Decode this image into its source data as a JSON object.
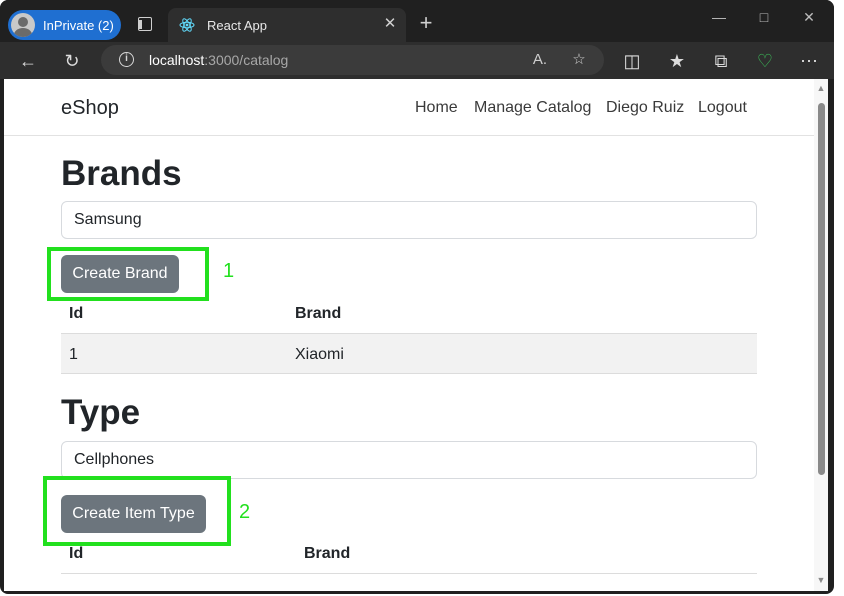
{
  "browser": {
    "profile_label": "InPrivate (2)",
    "tab_title": "React App",
    "tab_close": "✕",
    "new_tab": "+",
    "url_host": "localhost",
    "url_path": ":3000/catalog",
    "icons": [
      "tabs-icon",
      "react-icon",
      "back-icon",
      "refresh-icon",
      "info-icon",
      "read-aloud-icon",
      "favorite-star-icon",
      "split-screen-icon",
      "favorites-icon",
      "collections-icon",
      "health-icon",
      "more-icon"
    ]
  },
  "app": {
    "brand": "eShop",
    "nav": [
      "Home",
      "Manage Catalog",
      "Diego Ruiz",
      "Logout"
    ]
  },
  "brands": {
    "heading": "Brands",
    "input_value": "Samsung",
    "button": "Create Brand",
    "annotation": "1",
    "columns": [
      "Id",
      "Brand"
    ],
    "rows": [
      {
        "id": "1",
        "brand": "Xiaomi"
      }
    ]
  },
  "types": {
    "heading": "Type",
    "input_value": "Cellphones",
    "button": "Create Item Type",
    "annotation": "2",
    "columns": [
      "Id",
      "Brand"
    ]
  },
  "colors": {
    "highlight": "#22e01e",
    "button": "#6c757d",
    "profile": "#1f6fd1"
  }
}
